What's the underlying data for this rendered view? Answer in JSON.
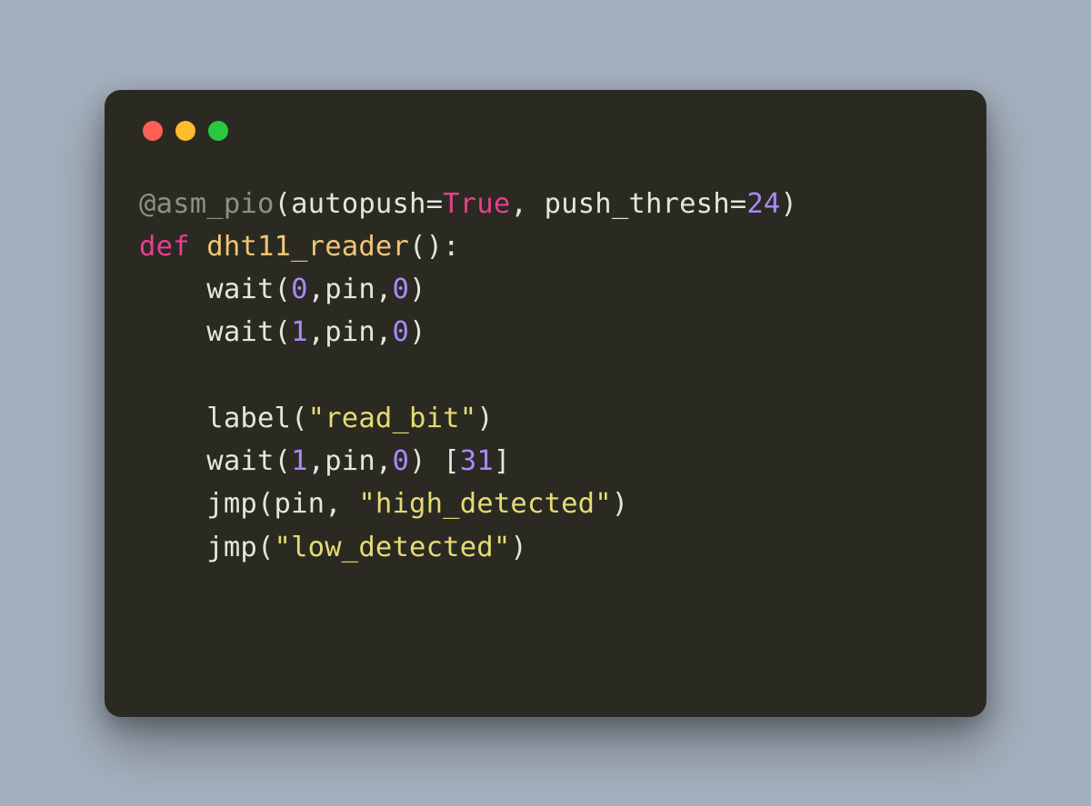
{
  "colors": {
    "red": "#ff5f57",
    "yellow": "#febc2e",
    "green": "#28c840"
  },
  "code": {
    "l1": {
      "decorator": "@asm_pio",
      "lp": "(",
      "arg1": "autopush=",
      "true": "True",
      "comma1": ", ",
      "arg2": "push_thresh=",
      "num": "24",
      "rp": ")"
    },
    "l2": {
      "def": "def ",
      "name": "dht11_reader",
      "parens": "():"
    },
    "l3": {
      "indent": "    ",
      "call": "wait(",
      "n1": "0",
      "mid": ",pin,",
      "n2": "0",
      "rp": ")"
    },
    "l4": {
      "indent": "    ",
      "call": "wait(",
      "n1": "1",
      "mid": ",pin,",
      "n2": "0",
      "rp": ")"
    },
    "l5": "",
    "l6": {
      "indent": "    ",
      "call": "label(",
      "str": "\"read_bit\"",
      "rp": ")"
    },
    "l7": {
      "indent": "    ",
      "call": "wait(",
      "n1": "1",
      "mid": ",pin,",
      "n2": "0",
      "rp": ") [",
      "delay": "31",
      "rb": "]"
    },
    "l8": {
      "indent": "    ",
      "call": "jmp(pin, ",
      "str": "\"high_detected\"",
      "rp": ")"
    },
    "l9": {
      "indent": "    ",
      "call": "jmp(",
      "str": "\"low_detected\"",
      "rp": ")"
    }
  }
}
